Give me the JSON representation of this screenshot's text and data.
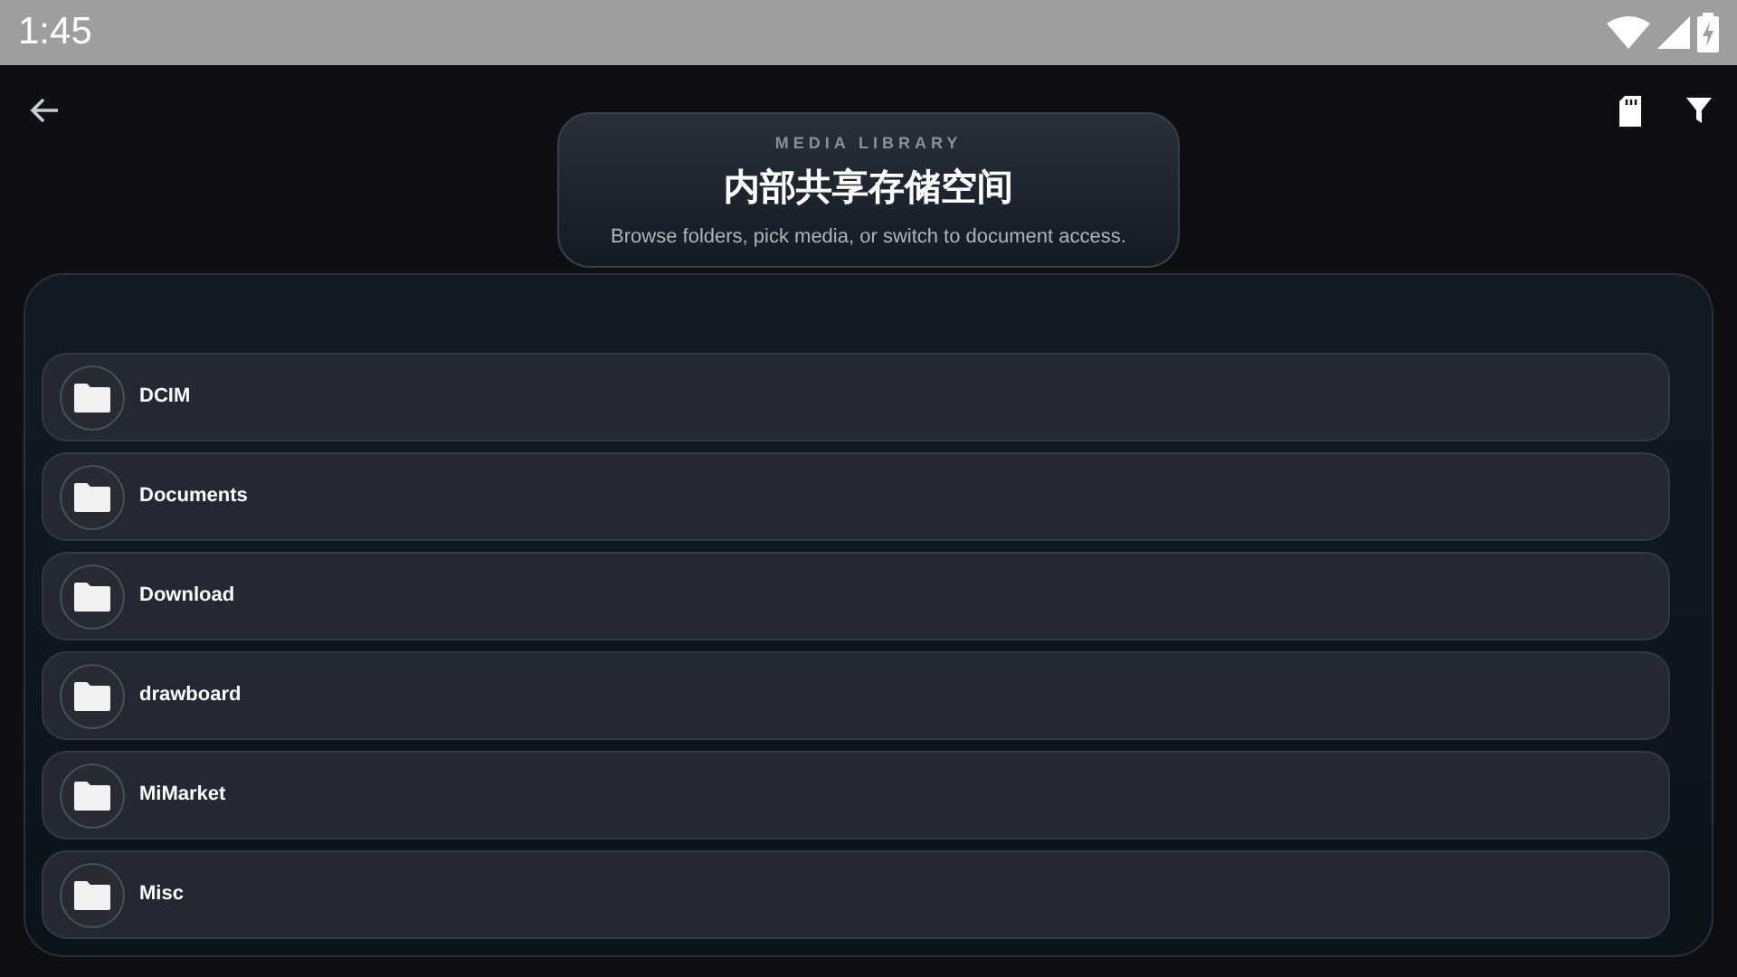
{
  "status_bar": {
    "time": "1:45"
  },
  "header": {
    "eyebrow": "MEDIA LIBRARY",
    "title": "内部共享存储空间",
    "subtitle": "Browse folders, pick media, or switch to document access."
  },
  "folders": [
    {
      "name": "DCIM"
    },
    {
      "name": "Documents"
    },
    {
      "name": "Download"
    },
    {
      "name": "drawboard"
    },
    {
      "name": "MiMarket"
    },
    {
      "name": "Misc"
    }
  ]
}
